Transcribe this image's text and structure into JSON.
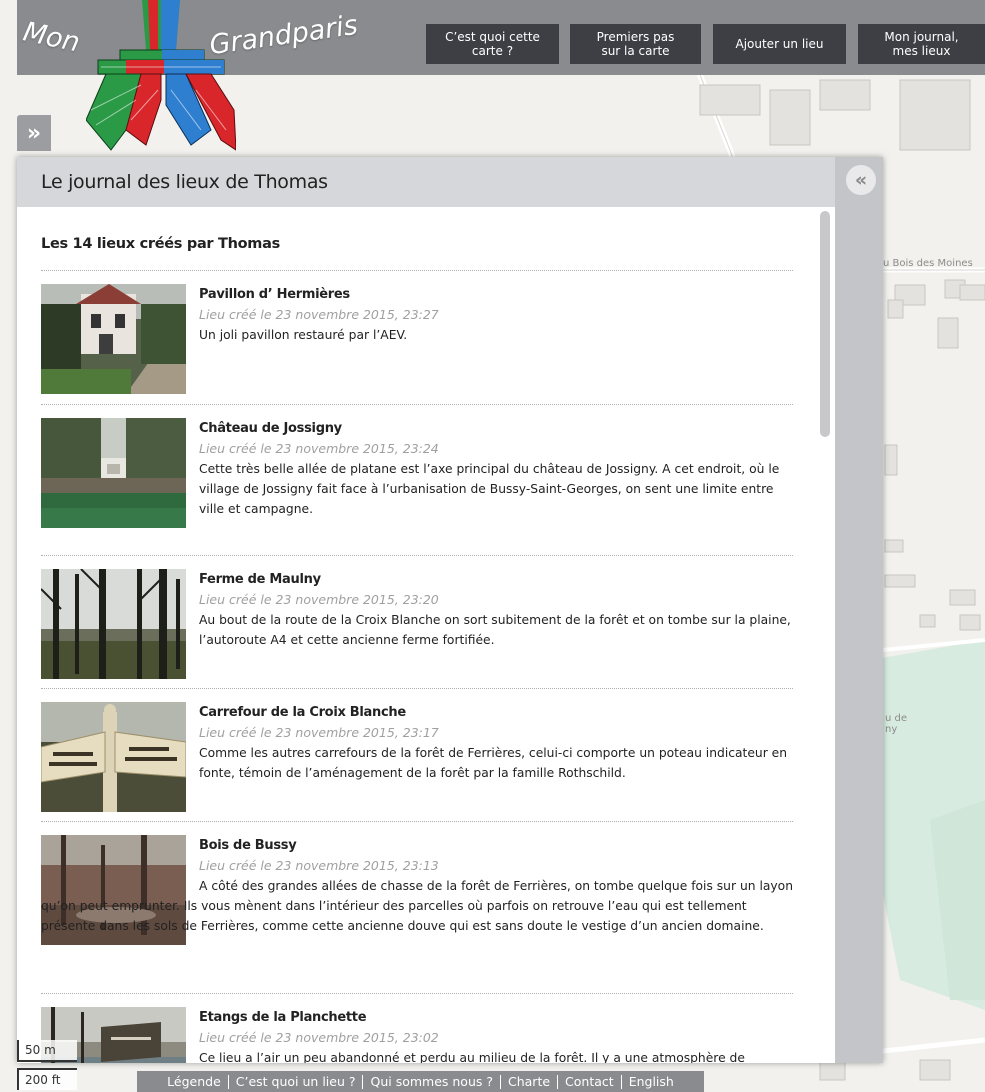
{
  "app": {
    "logo_word_1": "Mon",
    "logo_word_2": "Grandparis"
  },
  "nav": {
    "items": [
      {
        "label": "C’est quoi cette\ncarte ?"
      },
      {
        "label": "Premiers pas\nsur la carte"
      },
      {
        "label": "Ajouter un lieu"
      },
      {
        "label": "Mon journal,\nmes lieux"
      }
    ]
  },
  "map": {
    "labels": [
      "u Bois des Moines",
      "u de\nny"
    ]
  },
  "panel": {
    "title": "Le journal des lieux de Thomas",
    "expand_glyph": "»",
    "collapse_glyph": "«",
    "section_title": "Les 14 lieux créés par Thomas",
    "places": [
      {
        "name": "Pavillon d’ Hermières",
        "date": "Lieu créé le 23 novembre 2015, 23:27",
        "description": "Un joli pavillon restauré par l’AEV.",
        "thumb_icon": "house-photo"
      },
      {
        "name": "Château de Jossigny",
        "date": "Lieu créé le 23 novembre 2015, 23:24",
        "description": "Cette très belle allée de platane est l’axe principal du château de Jossigny. A cet endroit, où le village de Jossigny fait face à l’urbanisation de Bussy-Saint-Georges, on sent une limite entre ville et campagne.",
        "thumb_icon": "avenue-photo"
      },
      {
        "name": "Ferme de Maulny",
        "date": "Lieu créé le 23 novembre 2015, 23:20",
        "description": "Au bout de la route de la Croix Blanche on sort subitement de la forêt et on tombe sur la plaine, l’autoroute A4 et cette ancienne ferme fortifiée.",
        "thumb_icon": "forest-photo"
      },
      {
        "name": "Carrefour de la Croix Blanche",
        "date": "Lieu créé le 23 novembre 2015, 23:17",
        "description": "Comme les autres carrefours de la forêt de Ferrières, celui-ci comporte un poteau indicateur en fonte, témoin de l’aménagement de la forêt par la famille Rothschild.",
        "thumb_icon": "signpost-photo"
      },
      {
        "name": "Bois de Bussy",
        "date": "Lieu créé le 23 novembre 2015, 23:13",
        "description": "A côté des grandes allées de chasse de la forêt de Ferrières, on tombe quelque fois sur un layon qu’on peut emprunter. Ils vous mènent dans l’intérieur des parcelles où parfois on retrouve l’eau qui est tellement présente dans les sols de Ferrières, comme cette ancienne douve qui est sans doute le vestige d’un ancien domaine.",
        "thumb_icon": "woodland-photo"
      },
      {
        "name": "Etangs de la Planchette",
        "date": "Lieu créé le 23 novembre 2015, 23:02",
        "description": "Ce lieu a l’air un peu abandonné et perdu au milieu de la forêt. Il y a une atmosphère de",
        "thumb_icon": "pond-photo"
      }
    ]
  },
  "scale": {
    "metric": "50 m",
    "imperial": "200 ft"
  },
  "footer": {
    "links": [
      "Légende",
      "C’est quoi un lieu ?",
      "Qui sommes nous ?",
      "Charte",
      "Contact",
      "English"
    ]
  },
  "colors": {
    "header_bg": "#8a8b8e",
    "nav_button_bg": "#3d3f44",
    "panel_header_bg": "#d6d7da",
    "panel_frame_bg": "#c4c5c8",
    "map_bg": "#f2f1ee",
    "map_green": "#d7ebe0"
  }
}
